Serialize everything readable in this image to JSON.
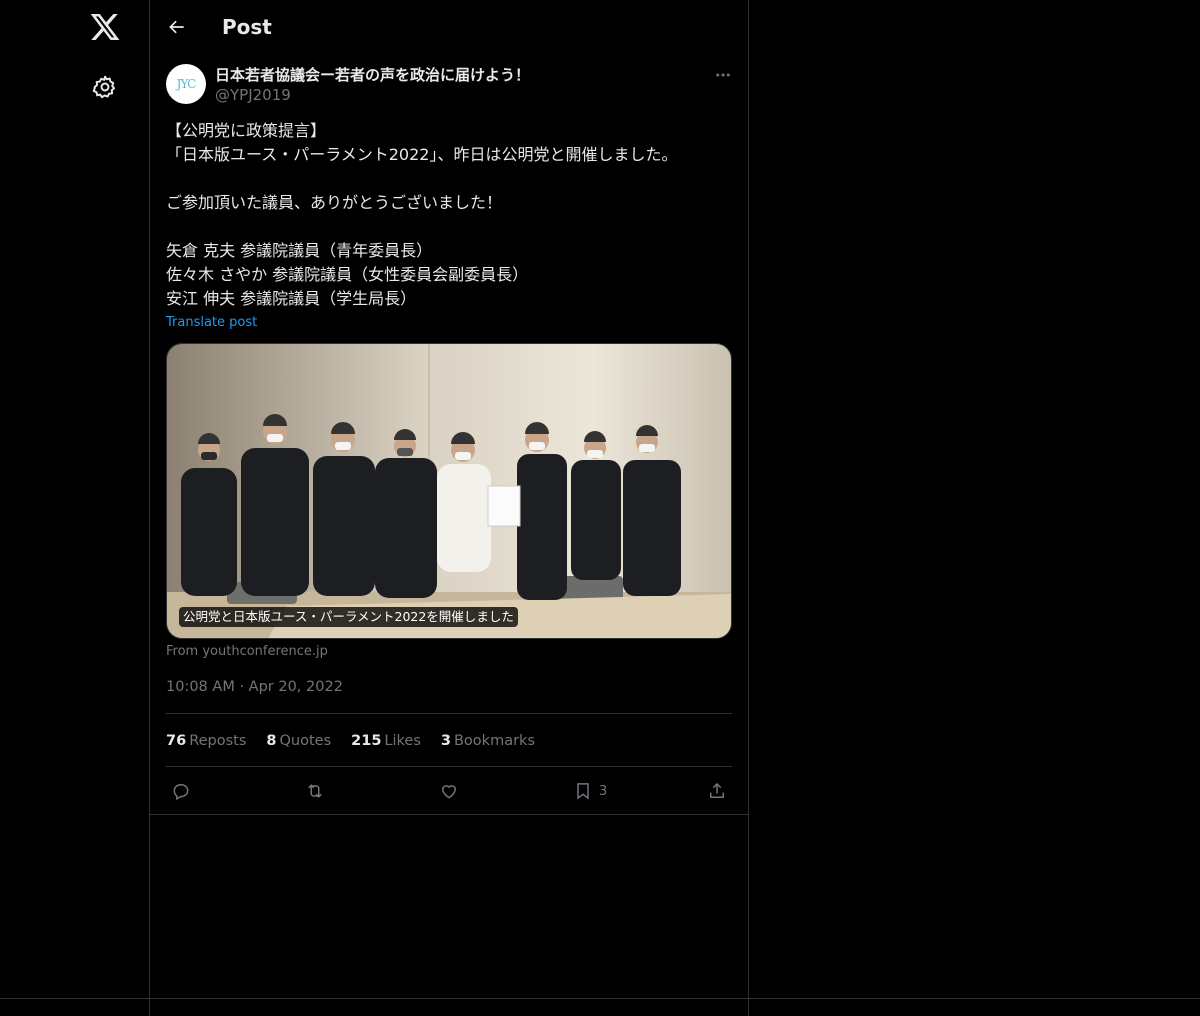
{
  "header": {
    "title": "Post"
  },
  "author": {
    "name": "日本若者協議会ー若者の声を政治に届けよう！",
    "handle": "@YPJ2019",
    "avatar_text": "JYC"
  },
  "post": {
    "lines": [
      "【公明党に政策提言】",
      "「日本版ユース・パーラメント2022」、昨日は公明党と開催しました。",
      "",
      "ご参加頂いた議員、ありがとうございました！",
      "",
      "矢倉 克夫 参議院議員（青年委員長）",
      "佐々木 さやか 参議院議員（女性委員会副委員長）",
      "安江 伸夫 参議院議員（学生局長）"
    ],
    "translate_label": "Translate post"
  },
  "card": {
    "caption": "公明党と日本版ユース・パーラメント2022を開催しました",
    "source": "From youthconference.jp"
  },
  "meta": {
    "time": "10:08 AM",
    "separator": "·",
    "date": "Apr 20, 2022"
  },
  "stats": {
    "reposts_count": "76",
    "reposts_label": "Reposts",
    "quotes_count": "8",
    "quotes_label": "Quotes",
    "likes_count": "215",
    "likes_label": "Likes",
    "bookmarks_count": "3",
    "bookmarks_label": "Bookmarks"
  },
  "actions": {
    "bookmark_count": "3"
  },
  "icons": {
    "logo": "x-logo-icon",
    "settings": "gear-icon",
    "back": "arrow-left-icon",
    "more": "more-horizontal-icon",
    "reply": "reply-icon",
    "repost": "repost-icon",
    "like": "heart-icon",
    "bookmark": "bookmark-icon",
    "share": "share-icon"
  },
  "colors": {
    "background": "#000000",
    "text": "#e7e9ea",
    "muted": "#71767b",
    "accent": "#1d9bf0",
    "border": "#2f3336"
  }
}
